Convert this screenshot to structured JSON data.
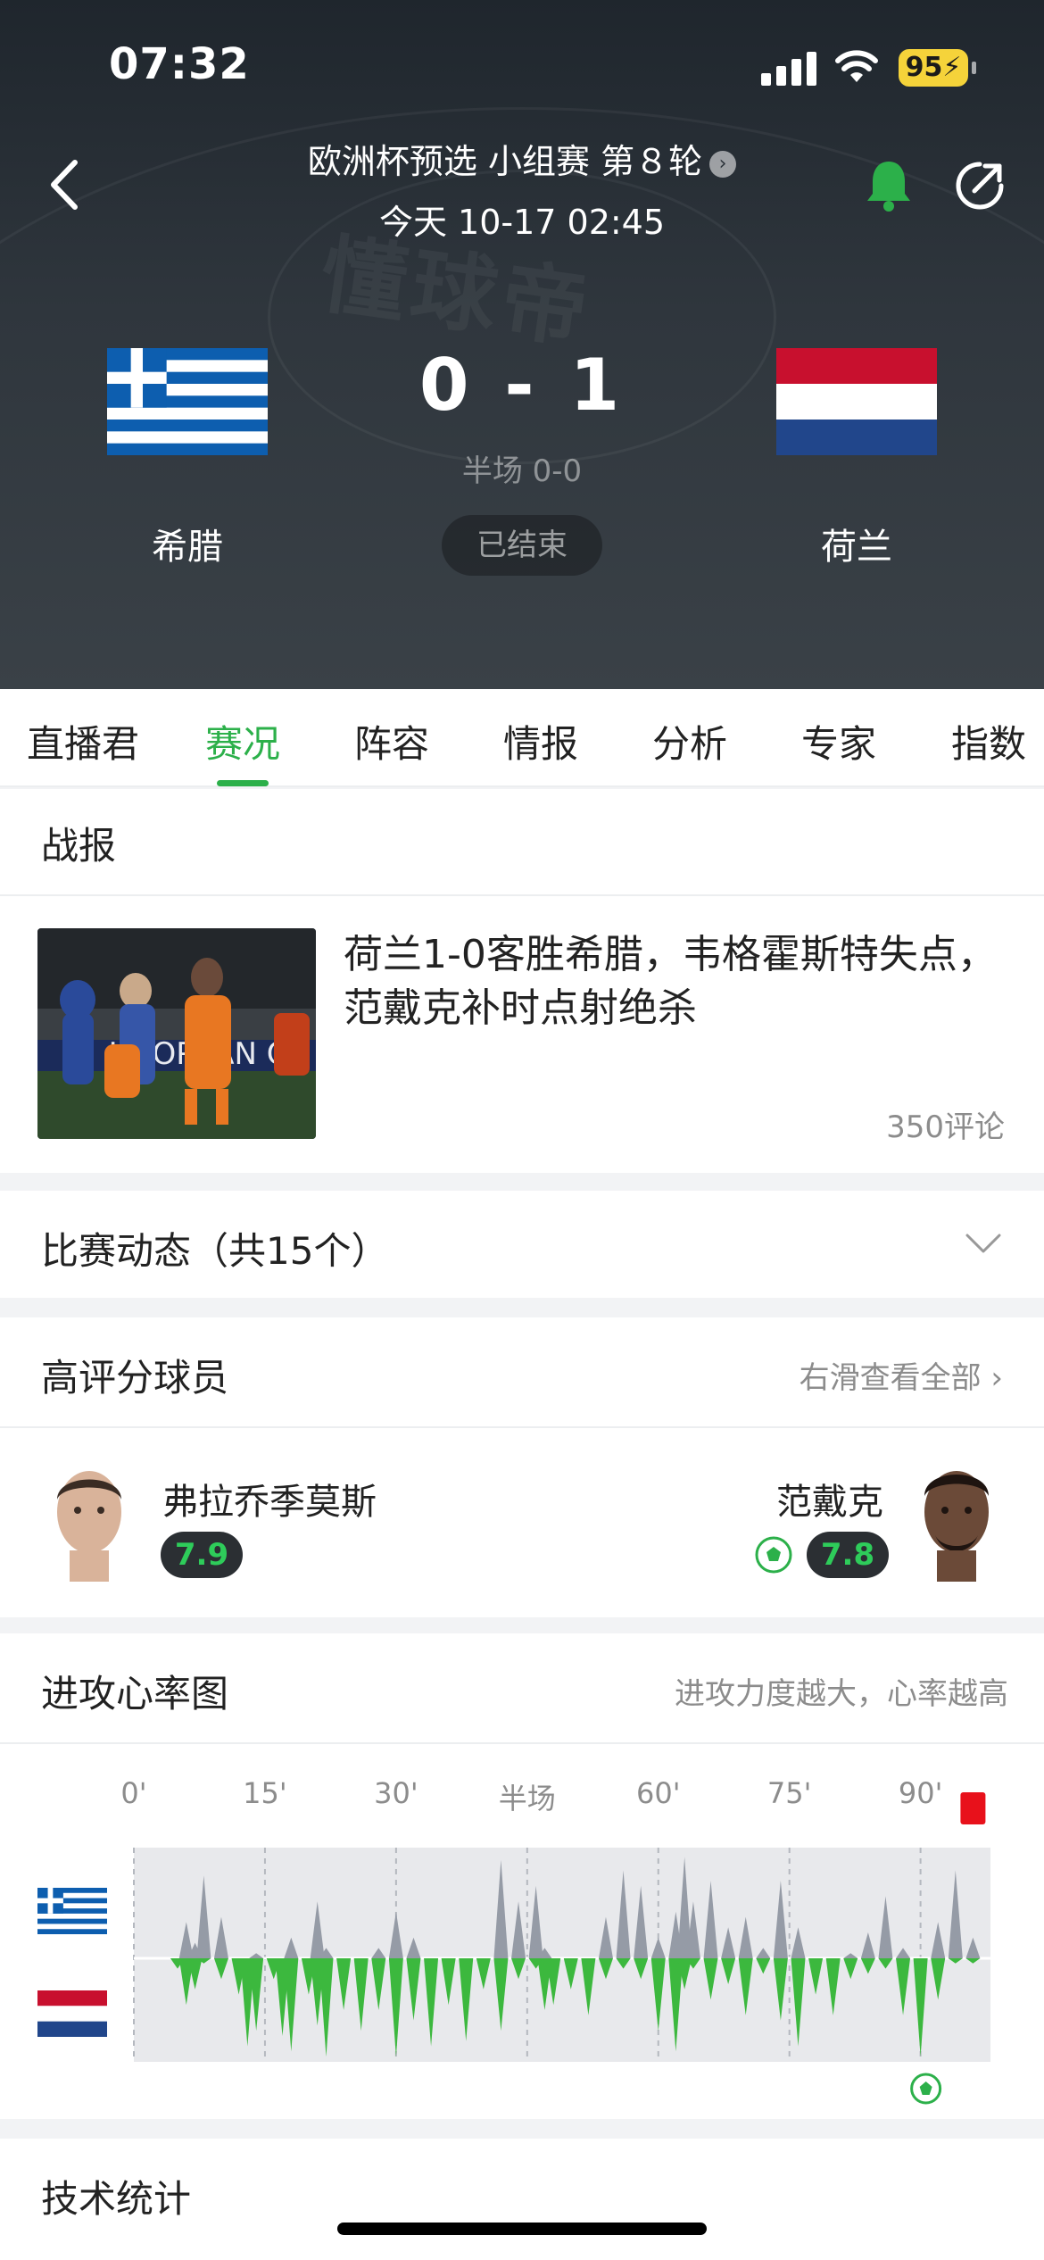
{
  "status_bar": {
    "time": "07:32",
    "battery": "95"
  },
  "header": {
    "competition": "欧洲杯预选 小组赛 第８轮",
    "match_time": "今天 10-17 02:45",
    "home_team": "希腊",
    "away_team": "荷兰",
    "score": "0 - 1",
    "halftime": "半场 0-0",
    "status": "已结束",
    "watermark": "懂球帝"
  },
  "tabs": [
    {
      "label": "直播君"
    },
    {
      "label": "赛况",
      "active": true
    },
    {
      "label": "阵容"
    },
    {
      "label": "情报"
    },
    {
      "label": "分析"
    },
    {
      "label": "专家"
    },
    {
      "label": "指数"
    }
  ],
  "report": {
    "title": "战报",
    "headline": "荷兰1-0客胜希腊，韦格霍斯特失点，范戴克补时点射绝杀",
    "comments": "350评论",
    "thumb_text": "UROPEAN Q"
  },
  "events": {
    "title": "比赛动态（共15个）"
  },
  "top_players": {
    "title": "高评分球员",
    "more": "右滑查看全部",
    "home": {
      "name": "弗拉乔季莫斯",
      "rating": "7.9"
    },
    "away": {
      "name": "范戴克",
      "rating": "7.8"
    }
  },
  "attack_chart": {
    "title": "进攻心率图",
    "subtitle": "进攻力度越大，心率越高",
    "ticks": [
      "0'",
      "15'",
      "30'",
      "半场",
      "60'",
      "75'",
      "90'"
    ]
  },
  "stats": {
    "title": "技术统计"
  },
  "colors": {
    "accent": "#2cb04a",
    "away_bar": "#3cb83e",
    "home_bar": "#959ba6",
    "card_red": "#e8111b"
  },
  "chart_data": {
    "type": "area",
    "title": "进攻心率图",
    "x_ticks": [
      "0'",
      "15'",
      "30'",
      "半场",
      "60'",
      "75'",
      "90'"
    ],
    "xlim": [
      0,
      98
    ],
    "ylim": [
      -1,
      1
    ],
    "series": [
      {
        "name": "希腊",
        "x": [
          5,
          6,
          7,
          8,
          10,
          12,
          13,
          14,
          16,
          17,
          18,
          20,
          21,
          22,
          24,
          26,
          28,
          30,
          32,
          34,
          36,
          38,
          40,
          42,
          44,
          46,
          47,
          48,
          50,
          52,
          54,
          56,
          58,
          60,
          62,
          63,
          64,
          66,
          68,
          70,
          72,
          74,
          76,
          78,
          80,
          82,
          84,
          86,
          88,
          90,
          92,
          94,
          96
        ],
        "values": [
          0,
          0.35,
          0.15,
          0.8,
          0.4,
          0,
          0,
          0.05,
          0,
          0,
          0.2,
          0,
          0.55,
          0.1,
          0,
          0,
          0.1,
          0.45,
          0.2,
          0,
          0,
          0,
          0,
          0.95,
          0.55,
          0.7,
          0.1,
          0,
          0,
          0,
          0.4,
          0.85,
          0.7,
          0.2,
          0.45,
          0.98,
          0.55,
          0.75,
          0.3,
          0.4,
          0.1,
          0.75,
          0.3,
          0,
          0,
          0.05,
          0.25,
          0.6,
          0.1,
          0,
          0.35,
          0.85,
          0.2
        ]
      },
      {
        "name": "荷兰",
        "x": [
          5,
          6,
          7,
          8,
          10,
          12,
          13,
          14,
          16,
          17,
          18,
          20,
          21,
          22,
          24,
          26,
          28,
          30,
          32,
          34,
          36,
          38,
          40,
          42,
          44,
          46,
          47,
          48,
          50,
          52,
          54,
          56,
          58,
          60,
          62,
          63,
          64,
          66,
          68,
          70,
          72,
          74,
          76,
          78,
          80,
          82,
          84,
          86,
          88,
          90,
          92,
          94,
          96
        ],
        "values": [
          0.1,
          0.45,
          0.3,
          0.05,
          0.2,
          0.35,
          0.85,
          0.7,
          0.2,
          0.75,
          0.9,
          0.35,
          0.65,
          0.95,
          0.5,
          0.7,
          0.5,
          0.95,
          0.6,
          0.85,
          0.45,
          0.8,
          0.3,
          0.7,
          0.2,
          0.1,
          0.5,
          0.45,
          0.3,
          0.55,
          0.2,
          0.1,
          0.2,
          0.7,
          0.9,
          0.3,
          0.1,
          0.4,
          0.25,
          0.55,
          0.15,
          0.6,
          0.85,
          0.35,
          0.55,
          0.2,
          0.15,
          0.1,
          0.55,
          0.95,
          0.4,
          0.05,
          0.05
        ]
      }
    ],
    "events": [
      {
        "type": "goal",
        "team": "荷兰",
        "minute": 90
      },
      {
        "type": "red_card",
        "team": "希腊",
        "minute": 96
      }
    ]
  }
}
